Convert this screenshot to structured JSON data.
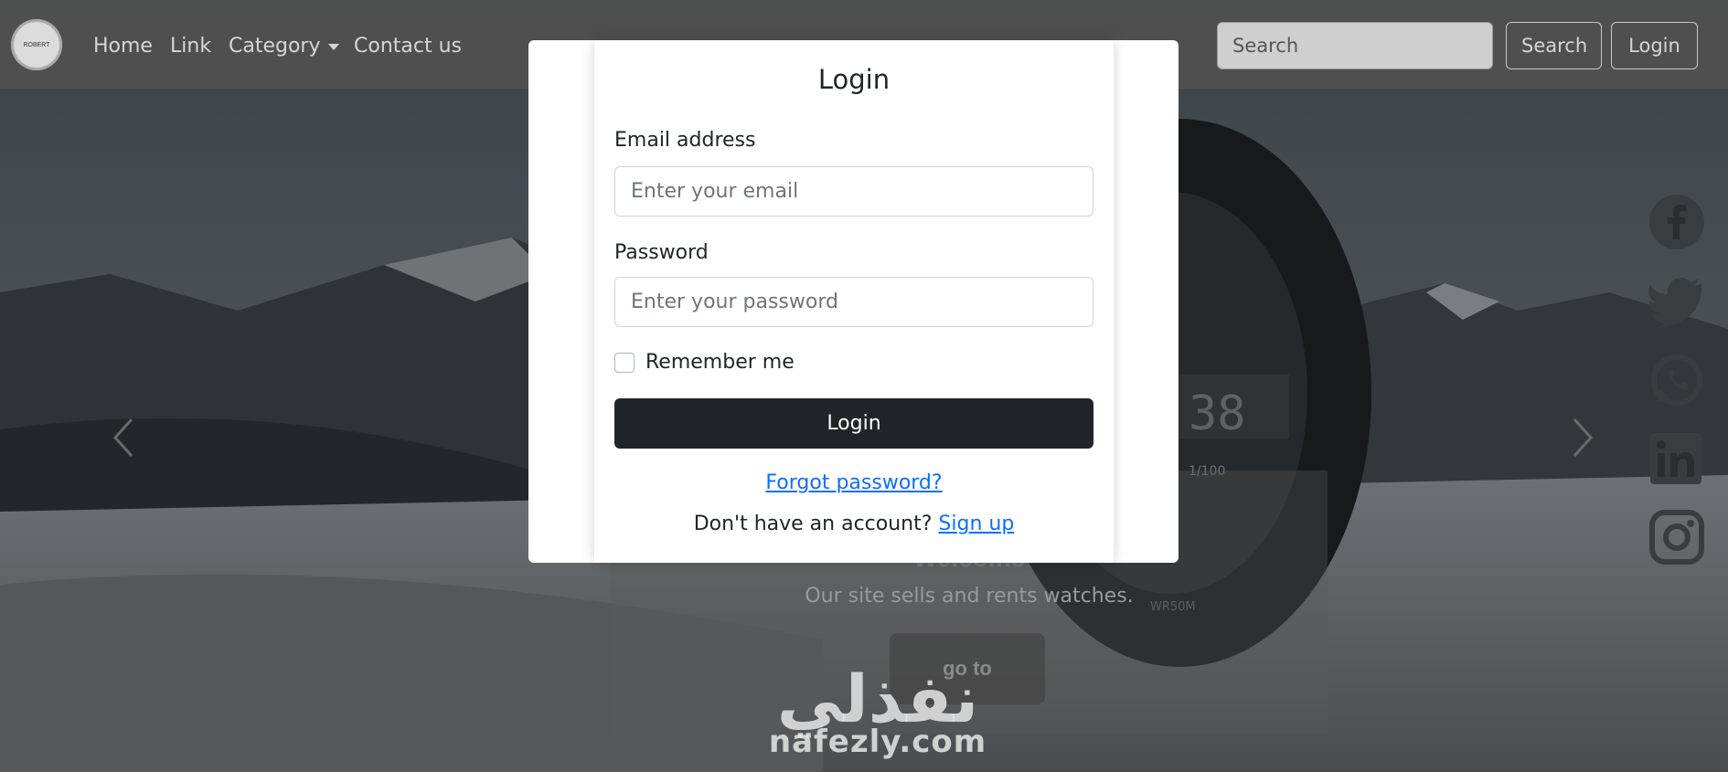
{
  "navbar": {
    "logo_text": "ROBERT",
    "links": [
      {
        "label": "Home"
      },
      {
        "label": "Link"
      },
      {
        "label": "Category"
      },
      {
        "label": "Contact us"
      }
    ],
    "search_placeholder": "Search",
    "search_button": "Search",
    "login_button": "Login"
  },
  "carousel": {
    "caption_title": "Welcome",
    "caption_text": "Our site sells and rents watches.",
    "cta_label": "go to",
    "prev_icon": "chevron-left-icon",
    "next_icon": "chevron-right-icon"
  },
  "social": {
    "icons": [
      "facebook-icon",
      "twitter-icon",
      "whatsapp-icon",
      "linkedin-icon",
      "instagram-icon"
    ]
  },
  "watermark": {
    "arabic": "نفذلي",
    "latin": "nafezly.com"
  },
  "modal": {
    "title": "Login",
    "email_label": "Email address",
    "email_placeholder": "Enter your email",
    "password_label": "Password",
    "password_placeholder": "Enter your password",
    "remember_label": "Remember me",
    "submit_label": "Login",
    "forgot_link": "Forgot password?",
    "no_account_text": "Don't have an account?",
    "signup_link": "Sign up"
  },
  "colors": {
    "primary_link": "#0d6efd",
    "dark_button": "#212529",
    "navbar_bg": "#505050"
  }
}
